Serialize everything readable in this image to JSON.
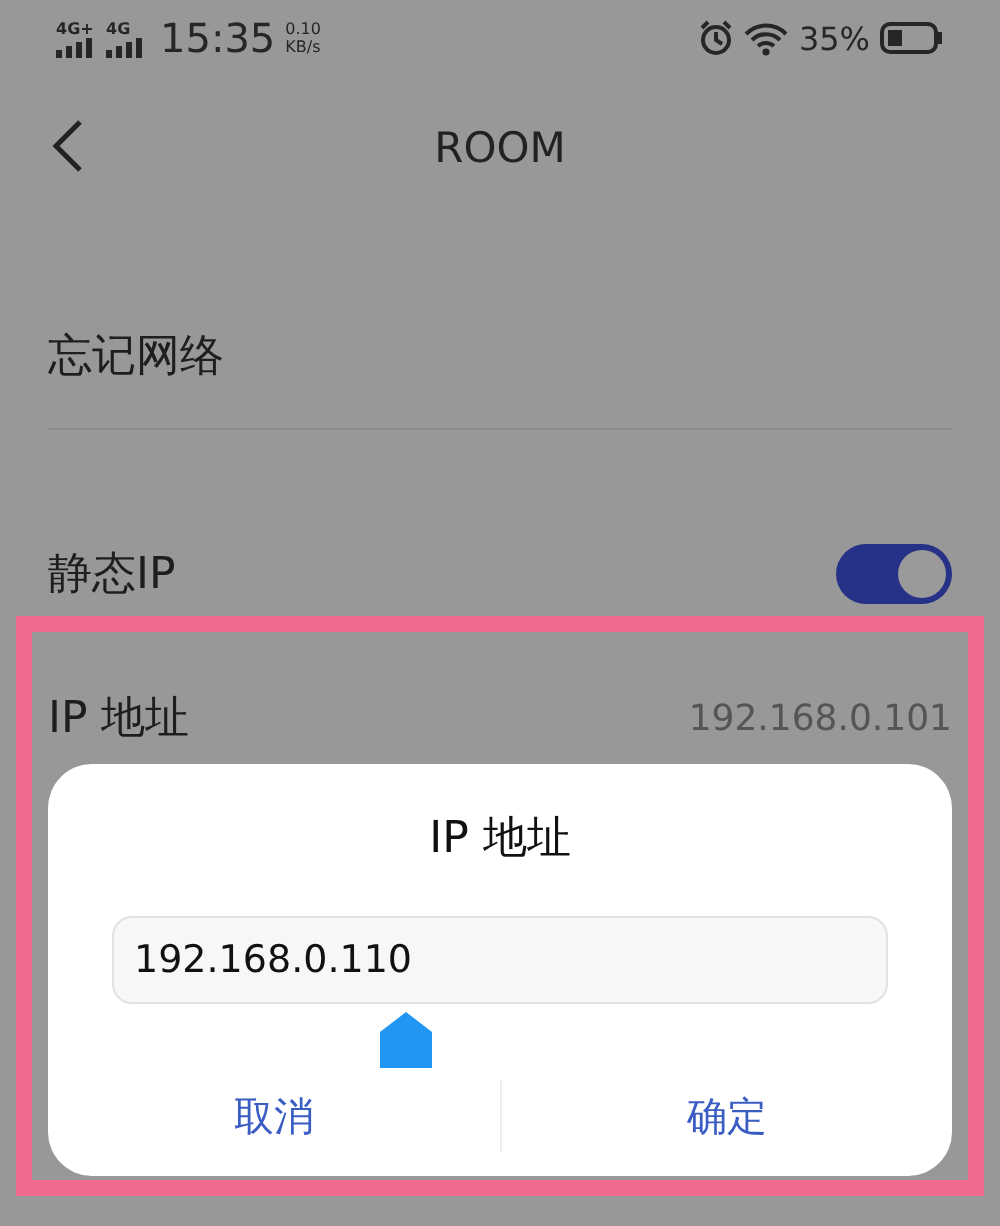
{
  "status_bar": {
    "networks": [
      "4G+",
      "4G"
    ],
    "time": "15:35",
    "speed": "0.10",
    "speed_unit": "KB/s",
    "battery": "35%"
  },
  "header": {
    "title": "ROOM"
  },
  "rows": [
    {
      "kind": "plain",
      "label": "忘记网络"
    },
    {
      "kind": "switch",
      "label": "静态IP",
      "on": true
    },
    {
      "kind": "value",
      "label": "IP 地址",
      "value": "192.168.0.101"
    }
  ],
  "dialog": {
    "title": "IP 地址",
    "value": "192.168.0.110",
    "buttons": [
      "取消",
      "确定"
    ]
  },
  "highlight": {
    "kind": "frame"
  }
}
